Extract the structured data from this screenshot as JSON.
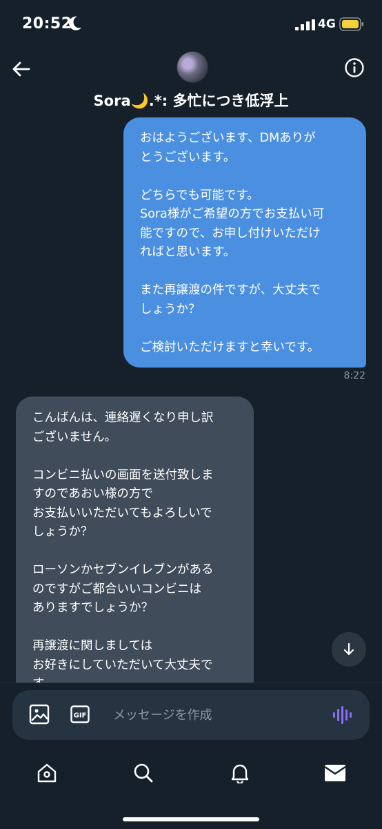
{
  "status_bar": {
    "time": "20:52",
    "network": "4G",
    "icons": [
      "moon-icon",
      "signal-icon",
      "battery-icon"
    ]
  },
  "header": {
    "title": "Sora🌙.*: 多忙につき低浮上",
    "back_icon": "arrow-left-icon",
    "info_icon": "info-icon"
  },
  "messages": [
    {
      "direction": "sent",
      "text": "おはようございます、DMありが\nとうございます。\n\nどちらでも可能です。\nSora様がご希望の方でお支払い可\n能ですので、お申し付けいただけ\nればと思います。\n\nまた再譲渡の件ですが、大丈夫で\nしょうか？\n\nご検討いただけますと幸いです。",
      "time": "8:22"
    },
    {
      "direction": "received",
      "text": "こんばんは、連絡遅くなり申し訳\nございません。\n\nコンビニ払いの画面を送付致しま\nすのであおい様の方で\nお支払いいただいてもよろしいで\nしょうか？\n\nローソンかセブンイレブンがある\nのですがご都合いいコンビニは\nありますでしょうか？\n\n再譲渡に関しましては\nお好きにしていただいて大丈夫で\nす。"
    }
  ],
  "composer": {
    "placeholder": "メッセージを作成",
    "gif_label": "GIF",
    "icons": [
      "image-icon",
      "gif-icon",
      "voice-wave-icon"
    ]
  },
  "tab_bar": {
    "items": [
      "home-icon",
      "search-icon",
      "bell-icon",
      "mail-icon"
    ]
  },
  "colors": {
    "background": "#15202b",
    "sent_bubble": "#4b8fe0",
    "received_bubble": "#404c5a",
    "voice_accent": "#8a6cf5",
    "battery": "#f5d13b"
  }
}
